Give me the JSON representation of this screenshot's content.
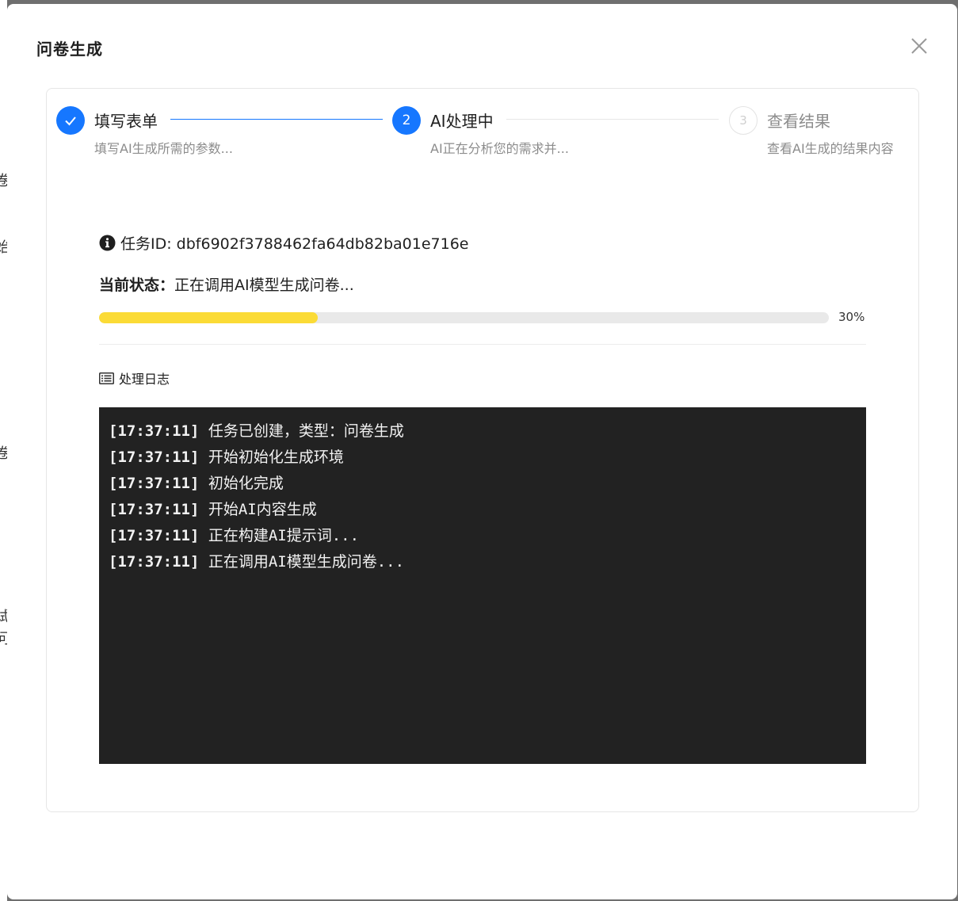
{
  "background": {
    "glyphs": [
      "卷",
      "始",
      "卷",
      "试",
      "问"
    ]
  },
  "modal": {
    "title": "问卷生成",
    "close_icon": "close-icon"
  },
  "steps": [
    {
      "number": "1",
      "title": "填写表单",
      "description": "填写AI生成所需的参数...",
      "status": "finish"
    },
    {
      "number": "2",
      "title": "AI处理中",
      "description": "AI正在分析您的需求并...",
      "status": "process"
    },
    {
      "number": "3",
      "title": "查看结果",
      "description": "查看AI生成的结果内容",
      "status": "wait"
    }
  ],
  "task": {
    "label": "任务ID: dbf6902f3788462fa64db82ba01e716e",
    "icon": "info-circle-icon"
  },
  "status": {
    "label": "当前状态：",
    "value": "正在调用AI模型生成问卷..."
  },
  "progress": {
    "percent": 30,
    "text": "30%",
    "color": "#fbdb36"
  },
  "log": {
    "title": "处理日志",
    "icon": "list-icon",
    "entries": [
      {
        "time": "[17:37:11]",
        "message": "任务已创建，类型：问卷生成"
      },
      {
        "time": "[17:37:11]",
        "message": "开始初始化生成环境"
      },
      {
        "time": "[17:37:11]",
        "message": "初始化完成"
      },
      {
        "time": "[17:37:11]",
        "message": "开始AI内容生成"
      },
      {
        "time": "[17:37:11]",
        "message": "正在构建AI提示词..."
      },
      {
        "time": "[17:37:11]",
        "message": "正在调用AI模型生成问卷..."
      }
    ]
  },
  "colors": {
    "primary": "#1677ff",
    "log_bg": "#222222"
  }
}
